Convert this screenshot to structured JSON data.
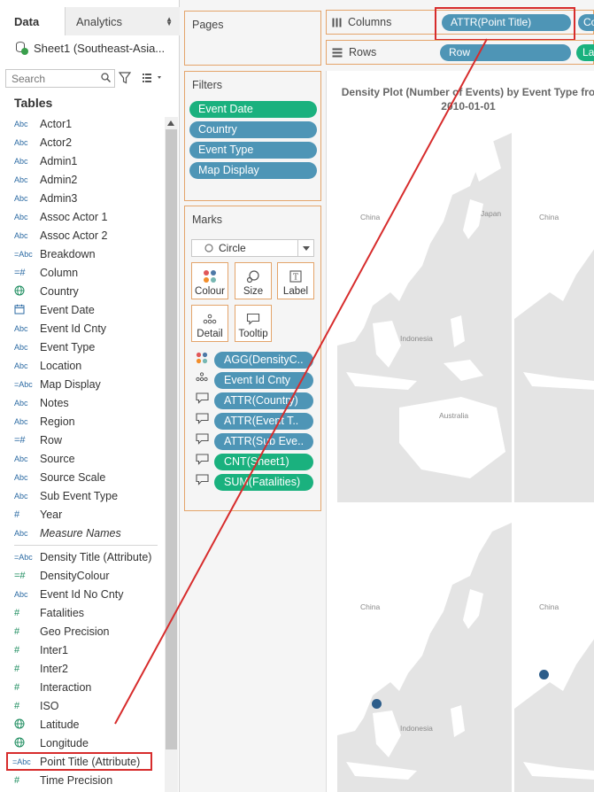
{
  "data_pane": {
    "tab_data": "Data",
    "tab_analytics": "Analytics",
    "datasource": "Sheet1 (Southeast-Asia...",
    "search_placeholder": "Search",
    "tables_heading": "Tables",
    "fields": [
      {
        "type": "Abc",
        "label": "Actor1"
      },
      {
        "type": "Abc",
        "label": "Actor2"
      },
      {
        "type": "Abc",
        "label": "Admin1"
      },
      {
        "type": "Abc",
        "label": "Admin2"
      },
      {
        "type": "Abc",
        "label": "Admin3"
      },
      {
        "type": "Abc",
        "label": "Assoc Actor 1"
      },
      {
        "type": "Abc",
        "label": "Assoc Actor 2"
      },
      {
        "type": "=Abc",
        "label": "Breakdown"
      },
      {
        "type": "=#",
        "label": "Column"
      },
      {
        "type": "globe",
        "label": "Country"
      },
      {
        "type": "calendar",
        "label": "Event Date"
      },
      {
        "type": "Abc",
        "label": "Event Id Cnty"
      },
      {
        "type": "Abc",
        "label": "Event Type"
      },
      {
        "type": "Abc",
        "label": "Location"
      },
      {
        "type": "=Abc",
        "label": "Map Display"
      },
      {
        "type": "Abc",
        "label": "Notes"
      },
      {
        "type": "Abc",
        "label": "Region"
      },
      {
        "type": "=#",
        "label": "Row"
      },
      {
        "type": "Abc",
        "label": "Source"
      },
      {
        "type": "Abc",
        "label": "Source Scale"
      },
      {
        "type": "Abc",
        "label": "Sub Event Type"
      },
      {
        "type": "#",
        "label": "Year"
      },
      {
        "type": "Abc",
        "label": "Measure Names",
        "italic": true
      }
    ],
    "measures": [
      {
        "type": "=Abc",
        "label": "Density Title (Attribute)"
      },
      {
        "type": "=#",
        "label": "DensityColour"
      },
      {
        "type": "Abc",
        "label": "Event Id No Cnty"
      },
      {
        "type": "#",
        "label": "Fatalities"
      },
      {
        "type": "#",
        "label": "Geo Precision"
      },
      {
        "type": "#",
        "label": "Inter1"
      },
      {
        "type": "#",
        "label": "Inter2"
      },
      {
        "type": "#",
        "label": "Interaction"
      },
      {
        "type": "#",
        "label": "ISO"
      },
      {
        "type": "globe",
        "label": "Latitude"
      },
      {
        "type": "globe",
        "label": "Longitude"
      },
      {
        "type": "=Abc",
        "label": "Point Title (Attribute)",
        "highlighted": true
      },
      {
        "type": "#",
        "label": "Time Precision"
      }
    ]
  },
  "pages": {
    "title": "Pages"
  },
  "filters": {
    "title": "Filters",
    "items": [
      "Event Date",
      "Country",
      "Event Type",
      "Map Display"
    ]
  },
  "marks": {
    "title": "Marks",
    "mark_type": "Circle",
    "buttons": [
      "Colour",
      "Size",
      "Label",
      "Detail",
      "Tooltip"
    ],
    "fields": [
      {
        "icon": "colour",
        "label": "AGG(DensityC..",
        "color": "blue"
      },
      {
        "icon": "detail",
        "label": "Event Id Cnty",
        "color": "blue"
      },
      {
        "icon": "tooltip",
        "label": "ATTR(Country)",
        "color": "blue"
      },
      {
        "icon": "tooltip",
        "label": "ATTR(Event T..",
        "color": "blue"
      },
      {
        "icon": "tooltip",
        "label": "ATTR(Sub Eve..",
        "color": "blue"
      },
      {
        "icon": "tooltip",
        "label": "CNT(Sheet1)",
        "color": "green"
      },
      {
        "icon": "tooltip",
        "label": "SUM(Fatalities)",
        "color": "green"
      }
    ]
  },
  "shelves": {
    "columns_label": "Columns",
    "rows_label": "Rows",
    "columns_pill": "ATTR(Point Title)",
    "columns_pill2": "Co",
    "rows_pill": "Row",
    "rows_pill2": "La"
  },
  "viz": {
    "title_line1": "Density Plot (Number of Events) by Event Type fro",
    "title_line2": "2010-01-01",
    "map_labels": {
      "china": "China",
      "japan": "Japan",
      "indonesia": "Indonesia",
      "australia": "Australia"
    }
  },
  "colors": {
    "accent_orange": "#e4a46a",
    "pill_green": "#1ab17e",
    "pill_blue": "#4e95b6",
    "annotation_red": "#d72c2c",
    "map_land": "#ffffff",
    "map_sea": "#e4e4e4",
    "mark_dot": "#2d5d8a"
  }
}
